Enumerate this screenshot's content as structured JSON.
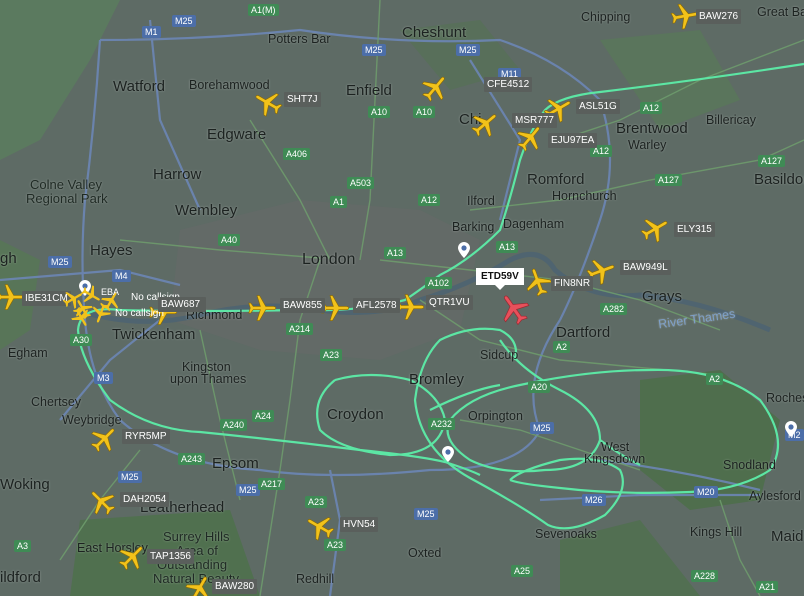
{
  "colors": {
    "track": "#5ce6a4",
    "plane_yellow": "#f2c21a",
    "plane_selected": "#e8505b",
    "label_bg": "#5a5f5c",
    "road_m": "#4c6ea8",
    "road_a": "#3f8b55"
  },
  "selected_flight": {
    "callsign": "ETD59V"
  },
  "places": {
    "watford": "Watford",
    "borehamwood": "Borehamwood",
    "potters_bar": "Potters Bar",
    "cheshunt": "Cheshunt",
    "chipping": "Chipping",
    "great_ba": "Great Ba",
    "enfield": "Enfield",
    "edgware": "Edgware",
    "harrow": "Harrow",
    "wembley": "Wembley",
    "colne_valley": "Colne Valley",
    "regional_park": "Regional Park",
    "hayes": "Hayes",
    "london": "London",
    "ilford": "Ilford",
    "barking": "Barking",
    "dagenham": "Dagenham",
    "romford": "Romford",
    "hornchurch": "Hornchurch",
    "brentwood": "Brentwood",
    "warley": "Warley",
    "billericay": "Billericay",
    "basildon": "Basildon",
    "grays": "Grays",
    "river_thames": "River Thames",
    "dartford": "Dartford",
    "twickenham": "Twickenham",
    "richmond": "Richmond",
    "kingston": "Kingston",
    "upon_thames": "upon Thames",
    "egham": "Egham",
    "chertsey": "Chertsey",
    "weybridge": "Weybridge",
    "croydon": "Croydon",
    "bromley": "Bromley",
    "sidcup": "Sidcup",
    "orpington": "Orpington",
    "west": "West",
    "kingsdown": "Kingsdown",
    "epsom": "Epsom",
    "woking": "Woking",
    "leatherhead": "Leatherhead",
    "east_horsley": "East Horsley",
    "surrey_hills": "Surrey Hills",
    "area_of": "Area of",
    "outstanding": "Outstanding",
    "natural_beauty": "Natural Beauty",
    "redhill": "Redhill",
    "oxted": "Oxted",
    "sevenoaks": "Sevenoaks",
    "snodland": "Snodland",
    "aylesford": "Aylesford",
    "kings_hill": "Kings Hill",
    "maid": "Maid",
    "roches": "Roches",
    "ildford": "ildford",
    "gh": "gh",
    "chi": "Chi"
  },
  "roads": [
    {
      "t": "m",
      "label": "M1"
    },
    {
      "t": "a",
      "label": "A1(M)"
    },
    {
      "t": "m",
      "label": "M25"
    },
    {
      "t": "m",
      "label": "M25"
    },
    {
      "t": "m",
      "label": "M25"
    },
    {
      "t": "a",
      "label": "A10"
    },
    {
      "t": "a",
      "label": "A10"
    },
    {
      "t": "m",
      "label": "M11"
    },
    {
      "t": "a",
      "label": "A12"
    },
    {
      "t": "a",
      "label": "A12"
    },
    {
      "t": "a",
      "label": "A127"
    },
    {
      "t": "a",
      "label": "A127"
    },
    {
      "t": "a",
      "label": "A406"
    },
    {
      "t": "a",
      "label": "A503"
    },
    {
      "t": "a",
      "label": "A1"
    },
    {
      "t": "a",
      "label": "A12"
    },
    {
      "t": "a",
      "label": "A13"
    },
    {
      "t": "a",
      "label": "A13"
    },
    {
      "t": "m",
      "label": "M25"
    },
    {
      "t": "a",
      "label": "A40"
    },
    {
      "t": "a",
      "label": "A102"
    },
    {
      "t": "a",
      "label": "A282"
    },
    {
      "t": "m",
      "label": "M4"
    },
    {
      "t": "a",
      "label": "A214"
    },
    {
      "t": "a",
      "label": "A23"
    },
    {
      "t": "a",
      "label": "A2"
    },
    {
      "t": "a",
      "label": "A2"
    },
    {
      "t": "a",
      "label": "A20"
    },
    {
      "t": "m",
      "label": "M3"
    },
    {
      "t": "a",
      "label": "A30"
    },
    {
      "t": "a",
      "label": "A240"
    },
    {
      "t": "a",
      "label": "A24"
    },
    {
      "t": "a",
      "label": "A232"
    },
    {
      "t": "m",
      "label": "M25"
    },
    {
      "t": "a",
      "label": "A243"
    },
    {
      "t": "m",
      "label": "M25"
    },
    {
      "t": "a",
      "label": "A217"
    },
    {
      "t": "a",
      "label": "A23"
    },
    {
      "t": "m",
      "label": "M26"
    },
    {
      "t": "m",
      "label": "M20"
    },
    {
      "t": "a",
      "label": "A3"
    },
    {
      "t": "a",
      "label": "A23"
    },
    {
      "t": "m",
      "label": "M25"
    },
    {
      "t": "a",
      "label": "A25"
    },
    {
      "t": "a",
      "label": "A228"
    },
    {
      "t": "m",
      "label": "M2"
    },
    {
      "t": "a",
      "label": "A21"
    },
    {
      "t": "m",
      "label": "M25"
    }
  ],
  "flights": [
    {
      "callsign": "BAW276"
    },
    {
      "callsign": "SHT7J"
    },
    {
      "callsign": "CFE4512"
    },
    {
      "callsign": "ASL51G"
    },
    {
      "callsign": "MSR777"
    },
    {
      "callsign": "EJU97EA"
    },
    {
      "callsign": "ELY315"
    },
    {
      "callsign": "BAW949L"
    },
    {
      "callsign": "FIN8NR"
    },
    {
      "callsign": "QTR1VU"
    },
    {
      "callsign": "AFL2578"
    },
    {
      "callsign": "BAW855"
    },
    {
      "callsign": "IBE31CM"
    },
    {
      "callsign": "BAW687"
    },
    {
      "callsign": "RYR5MP"
    },
    {
      "callsign": "DAH2054"
    },
    {
      "callsign": "HVN54"
    },
    {
      "callsign": "TAP1356"
    },
    {
      "callsign": "BAW280"
    }
  ],
  "heathrow_cluster": {
    "lbl1": "No callsign",
    "lbl2": "No callsign",
    "lbl3": "BAW687",
    "lbl4": "EBA",
    "lbl5": "IBE31CM"
  }
}
